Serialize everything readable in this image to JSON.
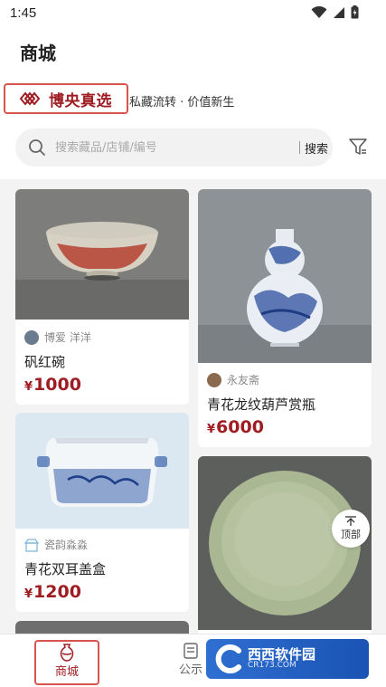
{
  "status_bar": {
    "time": "1:45"
  },
  "header": {
    "title": "商城",
    "brand": {
      "name": "博央真选",
      "slogan": "私藏流转 · 价值新生"
    },
    "search": {
      "placeholder": "搜索藏品/店铺/编号",
      "button_label": "搜索"
    }
  },
  "products": [
    {
      "shop": "博爱 洋洋",
      "name": "矾红碗",
      "currency": "¥",
      "price": "1000"
    },
    {
      "shop": "永友斋",
      "name": "青花龙纹葫芦赏瓶",
      "currency": "¥",
      "price": "6000"
    },
    {
      "shop": "瓷韵淼淼",
      "name": "青花双耳盖盒",
      "currency": "¥",
      "price": "1200"
    }
  ],
  "back_to_top": {
    "label": "顶部"
  },
  "tabbar": {
    "mall_label": "商城",
    "notice_label": "公示"
  },
  "watermark": {
    "text": "西西软件园",
    "url": "CR173.COM"
  },
  "colors": {
    "brand_red": "#9e1c22",
    "highlight_border": "#d9534f"
  }
}
